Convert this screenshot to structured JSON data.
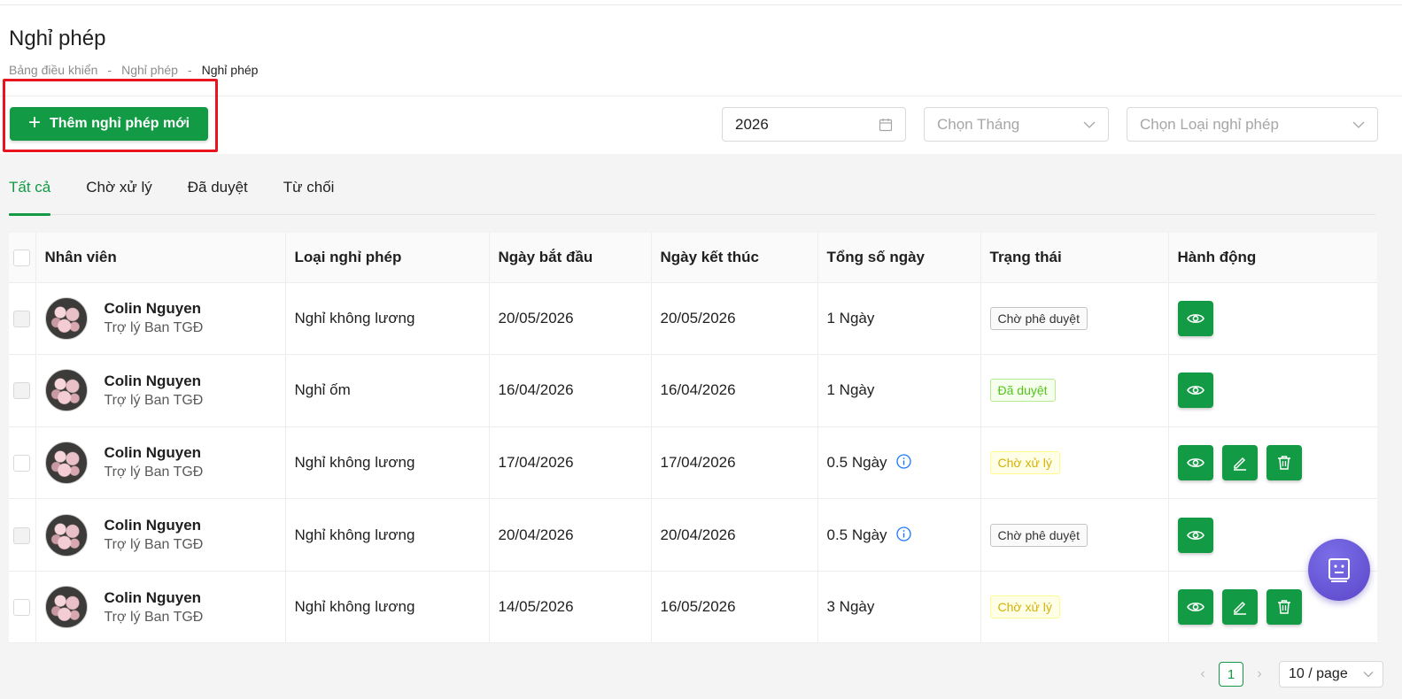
{
  "page": {
    "title": "Nghỉ phép"
  },
  "breadcrumb": [
    "Bảng điều khiển",
    "Nghỉ phép",
    "Nghỉ phép"
  ],
  "breadcrumb_separator": "-",
  "toolbar": {
    "add_button": "Thêm nghỉ phép mới",
    "year_value": "2026",
    "month_placeholder": "Chọn Tháng",
    "type_placeholder": "Chọn Loại nghỉ phép"
  },
  "tabs": [
    "Tất cả",
    "Chờ xử lý",
    "Đã duyệt",
    "Từ chối"
  ],
  "table": {
    "headers": [
      "Nhân viên",
      "Loại nghỉ phép",
      "Ngày bắt đầu",
      "Ngày kết thúc",
      "Tổng số ngày",
      "Trạng thái",
      "Hành động"
    ],
    "rows": [
      {
        "name": "Colin Nguyen",
        "role": "Trợ lý Ban TGĐ",
        "type": "Nghỉ không lương",
        "start": "20/05/2026",
        "end": "20/05/2026",
        "total": "1 Ngày",
        "status": "Chờ phê duyệt"
      },
      {
        "name": "Colin Nguyen",
        "role": "Trợ lý Ban TGĐ",
        "type": "Nghỉ ốm",
        "start": "16/04/2026",
        "end": "16/04/2026",
        "total": "1 Ngày",
        "status": "Đã duyệt"
      },
      {
        "name": "Colin Nguyen",
        "role": "Trợ lý Ban TGĐ",
        "type": "Nghỉ không lương",
        "start": "17/04/2026",
        "end": "17/04/2026",
        "total": "0.5 Ngày",
        "status": "Chờ xử lý"
      },
      {
        "name": "Colin Nguyen",
        "role": "Trợ lý Ban TGĐ",
        "type": "Nghỉ không lương",
        "start": "20/04/2026",
        "end": "20/04/2026",
        "total": "0.5 Ngày",
        "status": "Chờ phê duyệt"
      },
      {
        "name": "Colin Nguyen",
        "role": "Trợ lý Ban TGĐ",
        "type": "Nghỉ không lương",
        "start": "14/05/2026",
        "end": "16/05/2026",
        "total": "3 Ngày",
        "status": "Chờ xử lý"
      }
    ]
  },
  "pagination": {
    "current": "1",
    "page_size": "10 / page"
  },
  "colors": {
    "primary": "#129a44",
    "highlight": "#e8141e",
    "fab": "#6a5ad8"
  }
}
